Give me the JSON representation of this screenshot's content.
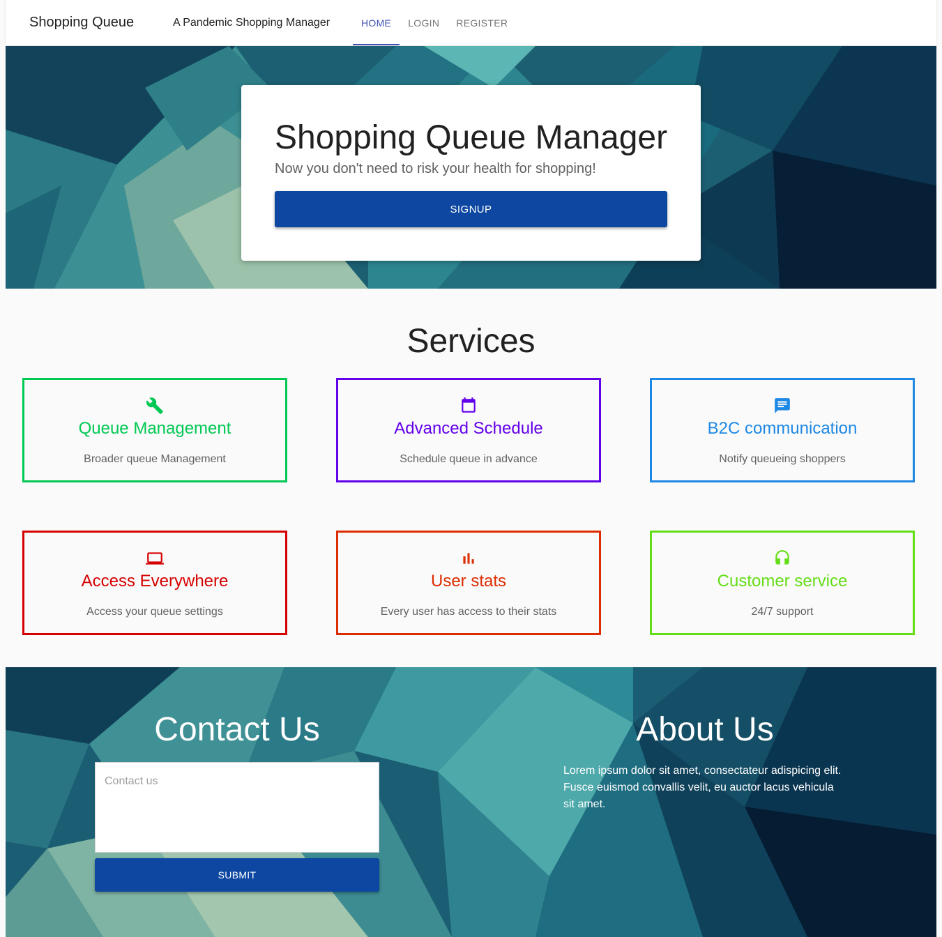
{
  "header": {
    "brand": "Shopping Queue",
    "tagline": "A Pandemic Shopping Manager",
    "nav": [
      {
        "label": "HOME",
        "active": true
      },
      {
        "label": "LOGIN",
        "active": false
      },
      {
        "label": "REGISTER",
        "active": false
      }
    ]
  },
  "hero": {
    "title": "Shopping Queue Manager",
    "subtitle": "Now you don't need to risk your health for shopping!",
    "signup_label": "SIGNUP"
  },
  "services": {
    "heading": "Services",
    "items": [
      {
        "title": "Queue Management",
        "description": "Broader queue Management",
        "icon": "wrench-icon",
        "color": "#00c853"
      },
      {
        "title": "Advanced Schedule",
        "description": "Schedule queue in advance",
        "icon": "calendar-icon",
        "color": "#6200ea"
      },
      {
        "title": "B2C communication",
        "description": "Notify queueing shoppers",
        "icon": "message-icon",
        "color": "#1e88e5"
      },
      {
        "title": "Access Everywhere",
        "description": "Access your queue settings",
        "icon": "laptop-icon",
        "color": "#d50000"
      },
      {
        "title": "User stats",
        "description": "Every user has access to their stats",
        "icon": "bar-chart-icon",
        "color": "#dd2c00"
      },
      {
        "title": "Customer service",
        "description": "24/7 support",
        "icon": "headset-icon",
        "color": "#64dd17"
      }
    ]
  },
  "contact": {
    "heading": "Contact Us",
    "placeholder": "Contact us",
    "submit_label": "SUBMIT"
  },
  "about": {
    "heading": "About Us",
    "text": "Lorem ipsum dolor sit amet, consectateur adispicing elit. Fusce euismod convallis velit, eu auctor lacus vehicula sit amet."
  },
  "colors": {
    "primary_button": "#0d47a1",
    "nav_active": "#3f51b5"
  }
}
